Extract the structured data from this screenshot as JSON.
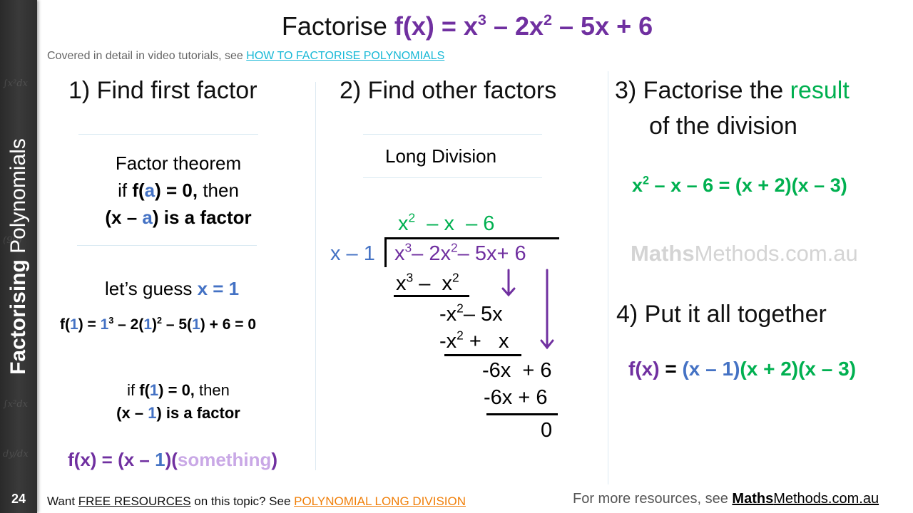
{
  "sidebar": {
    "title_bold": "Factorising",
    "title_rest": " Polynomials",
    "page_number": "24"
  },
  "title": {
    "lead": "Factorise ",
    "expr_a": "f(x) = x",
    "sup_a": "3",
    "expr_b": " – 2x",
    "sup_b": "2",
    "expr_c": " – 5x + 6"
  },
  "subtitle": {
    "text": "Covered  in detail in video tutorials, see ",
    "link": "HOW TO FACTORISE POLYNOMIALS"
  },
  "step1": {
    "heading": "1) Find first factor",
    "theorem_title": "Factor theorem",
    "theorem_line2": [
      "if ",
      "f(",
      "a",
      ") = 0,",
      " then"
    ],
    "theorem_line3": [
      "(x – ",
      "a",
      ") is  a factor"
    ],
    "guess_text": "let’s guess ",
    "guess_value": "x = 1",
    "eval": [
      "f(",
      "1",
      ") = ",
      "1",
      "3",
      " – 2(",
      "1",
      ")",
      "2",
      " – 5(",
      "1",
      ") + 6 = 0"
    ],
    "concl_line1": [
      "if ",
      "f(",
      "1",
      ") = 0,",
      " then"
    ],
    "concl_line2": [
      "(x – ",
      "1",
      ") is  a factor"
    ],
    "result": [
      "f(x) = (x – ",
      "1",
      ")(",
      "something",
      ")"
    ]
  },
  "step2": {
    "heading": "2) Find other factors",
    "method": "Long Division",
    "divisor": "x – 1",
    "quotient": [
      "x",
      "2",
      "  – x  – 6"
    ],
    "dividend": [
      "x",
      "3",
      "– 2x",
      "2",
      "– 5x+ 6"
    ],
    "rows": [
      {
        "parts": [
          "x",
          "3",
          " –  x",
          "2"
        ]
      },
      {
        "parts": [
          "-x",
          "2",
          "– 5x"
        ]
      },
      {
        "parts": [
          "-x",
          "2",
          " +   x"
        ]
      },
      {
        "parts": [
          "-6x  + 6"
        ]
      },
      {
        "parts": [
          "-6x + 6"
        ]
      },
      {
        "parts": [
          "0"
        ]
      }
    ]
  },
  "step3": {
    "heading_a": "3) Factorise the ",
    "heading_b": "result",
    "heading_c": "of the division",
    "equation": [
      "x",
      "2",
      " – x – 6 = (x + 2)(x – 3)"
    ]
  },
  "watermark": {
    "bold": "Maths",
    "rest": "Methods.com.au"
  },
  "step4": {
    "heading": "4) Put it all together",
    "equation": [
      "f(x)",
      " = ",
      "(x – 1)",
      "(x + 2)(x – 3)"
    ]
  },
  "footer": {
    "left_a": "Want ",
    "left_free": "FREE RESOURCES",
    "left_b": " on this topic? See ",
    "left_link": "POLYNOMIAL LONG DIVISION",
    "right_text": "For more resources, see ",
    "right_site_bold": "Maths",
    "right_site_rest": "Methods.com.au"
  },
  "colors": {
    "purple": "#7030a0",
    "blue": "#4472c4",
    "green": "#00b050",
    "lilac": "#c9a8e6",
    "link_cyan": "#17b8d6",
    "link_orange": "#f07f09"
  }
}
